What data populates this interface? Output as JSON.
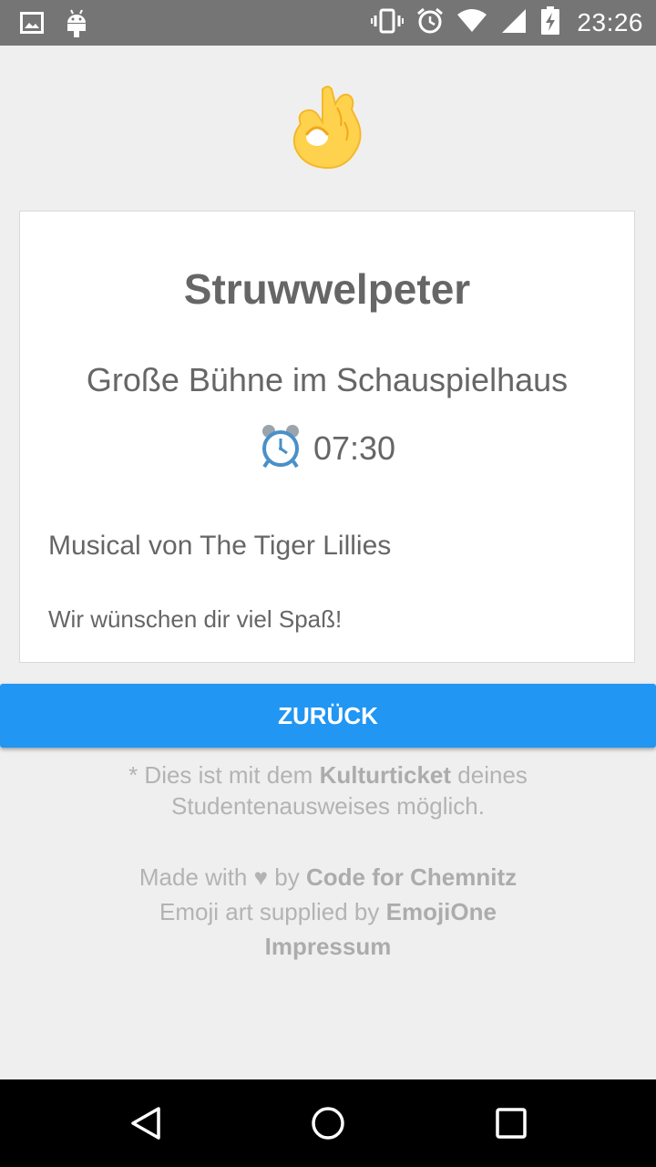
{
  "status_bar": {
    "time": "23:26",
    "icons": [
      "image-icon",
      "android-icon",
      "vibrate-icon",
      "alarm-icon",
      "wifi-icon",
      "cell-signal-icon",
      "battery-charging-icon"
    ]
  },
  "hero": {
    "icon": "ok-hand-emoji"
  },
  "event": {
    "title": "Struwwelpeter",
    "venue": "Große Bühne im Schauspielhaus",
    "time": "07:30",
    "time_icon": "alarm-clock-emoji",
    "description": "Musical von The Tiger Lillies",
    "wish": "Wir wünschen dir viel Spaß!"
  },
  "back_button": {
    "label": "ZURÜCK"
  },
  "footnote": {
    "prefix": "* Dies ist mit dem",
    "bold": "Kulturticket",
    "suffix": "deines Studentenausweises möglich."
  },
  "credits": {
    "made_with": "Made with",
    "heart": "♥",
    "by": "by",
    "org": "Code for Chemnitz",
    "emoji_prefix": "Emoji art supplied by",
    "emoji_provider": "EmojiOne",
    "impressum": "Impressum"
  },
  "nav_bar": {
    "buttons": [
      "back-triangle-icon",
      "home-circle-icon",
      "recents-square-icon"
    ]
  },
  "colors": {
    "status_bar": "#757575",
    "background": "#efefef",
    "accent": "#2196f3",
    "text": "#666666",
    "muted": "#b3b3b3"
  }
}
